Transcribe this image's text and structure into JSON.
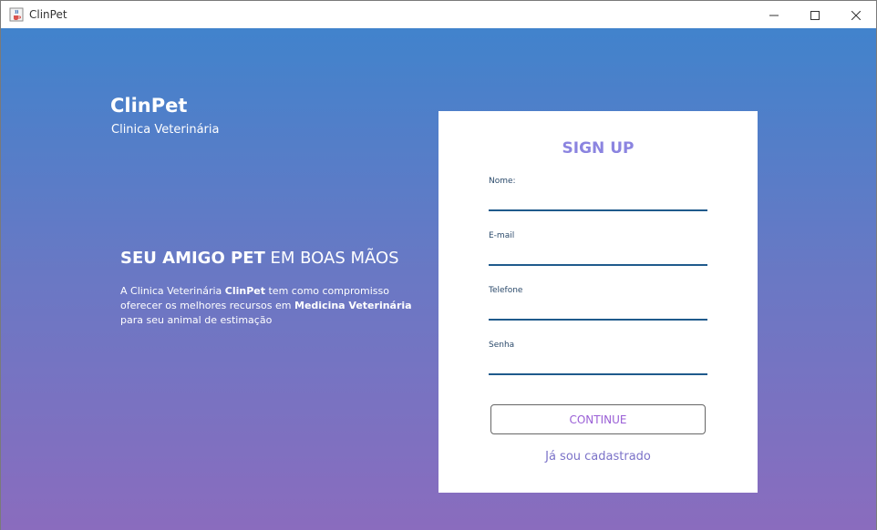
{
  "window": {
    "title": "ClinPet",
    "icon": "java-cup-icon",
    "controls": [
      "minimize-icon",
      "maximize-icon",
      "close-icon"
    ]
  },
  "brand": {
    "title": "ClinPet",
    "subtitle": "Clinica Veterinária"
  },
  "hero": {
    "headline_bold": "SEU AMIGO PET",
    "headline_rest": " EM BOAS MÃOS",
    "desc_1": "A Clinica Veterinária ",
    "desc_bold_1": "ClinPet",
    "desc_2": " tem como compromisso oferecer os melhores recursos em ",
    "desc_bold_2": "Medicina Veterinária",
    "desc_3": " para seu animal de estimação"
  },
  "form": {
    "title": "SIGN UP",
    "fields": [
      {
        "label": "Nome:",
        "value": ""
      },
      {
        "label": "E-mail",
        "value": ""
      },
      {
        "label": "Telefone",
        "value": ""
      },
      {
        "label": "Senha",
        "value": ""
      }
    ],
    "continue_label": "CONTINUE",
    "login_link": "Já sou cadastrado"
  },
  "colors": {
    "gradient_top": "#4183cc",
    "gradient_bottom": "#8a6cbe",
    "accent": "#8b84e0",
    "input_line": "#1f5a8c"
  }
}
